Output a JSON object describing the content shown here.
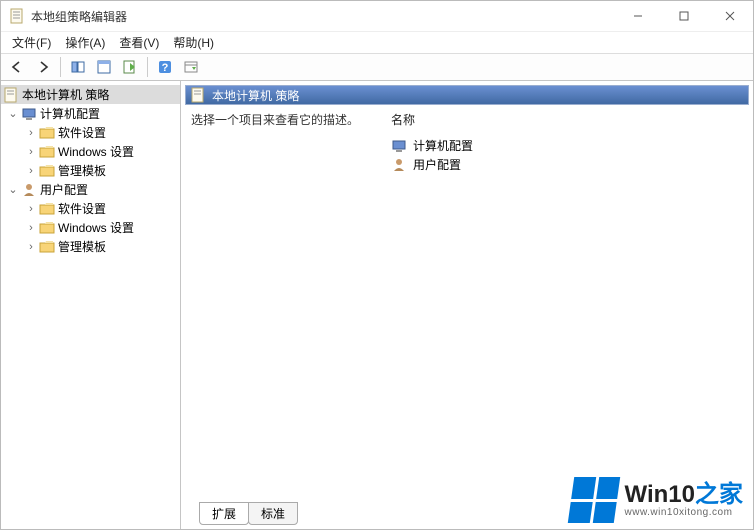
{
  "window": {
    "title": "本地组策略编辑器"
  },
  "menubar": {
    "file": "文件(F)",
    "action": "操作(A)",
    "view": "查看(V)",
    "help": "帮助(H)"
  },
  "tree": {
    "root": "本地计算机 策略",
    "computer": "计算机配置",
    "computer_children": {
      "software": "软件设置",
      "windows": "Windows 设置",
      "admin": "管理模板"
    },
    "user": "用户配置",
    "user_children": {
      "software": "软件设置",
      "windows": "Windows 设置",
      "admin": "管理模板"
    }
  },
  "header": {
    "title": "本地计算机 策略"
  },
  "content": {
    "description": "选择一个项目来查看它的描述。",
    "column_header": "名称",
    "items": {
      "computer": "计算机配置",
      "user": "用户配置"
    }
  },
  "tabs": {
    "extended": "扩展",
    "standard": "标准"
  },
  "watermark": {
    "brand_a": "Win10",
    "brand_b": "之家",
    "url": "www.win10xitong.com"
  }
}
